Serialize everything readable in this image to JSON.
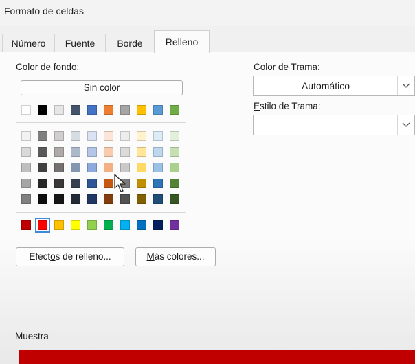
{
  "window": {
    "title": "Formato de celdas"
  },
  "tabs": [
    {
      "label": "Número",
      "active": false
    },
    {
      "label": "Fuente",
      "active": false
    },
    {
      "label": "Borde",
      "active": false
    },
    {
      "label": "Relleno",
      "active": true
    }
  ],
  "background_color": {
    "label_u": "C",
    "label_rest": "olor de fondo:",
    "no_color_label": "Sin color",
    "theme_row": [
      "#ffffff",
      "#000000",
      "#e7e6e6",
      "#44546a",
      "#4472c4",
      "#ed7d31",
      "#a5a5a5",
      "#ffc000",
      "#5b9bd5",
      "#70ad47"
    ],
    "tint_rows": [
      [
        "#f2f2f2",
        "#7f7f7f",
        "#d0cece",
        "#d6dce4",
        "#d9e1f2",
        "#fce4d6",
        "#ededed",
        "#fff2cc",
        "#ddebf7",
        "#e2efda"
      ],
      [
        "#d9d9d9",
        "#595959",
        "#aeaaaa",
        "#acb9ca",
        "#b4c6e7",
        "#f8cbad",
        "#dbdbdb",
        "#ffe699",
        "#bdd7ee",
        "#c6e0b4"
      ],
      [
        "#bfbfbf",
        "#404040",
        "#757171",
        "#8497b0",
        "#8ea9db",
        "#f4b084",
        "#c9c9c9",
        "#ffd966",
        "#9bc2e6",
        "#a9d08e"
      ],
      [
        "#a6a6a6",
        "#262626",
        "#3a3838",
        "#333f4f",
        "#2f5597",
        "#c65911",
        "#7b7b7b",
        "#bf8f00",
        "#2e75b6",
        "#548235"
      ],
      [
        "#808080",
        "#0d0d0d",
        "#161616",
        "#222b35",
        "#203764",
        "#833c0c",
        "#525252",
        "#806000",
        "#1f4e78",
        "#375623"
      ]
    ],
    "standard_row": [
      "#c00000",
      "#ff0000",
      "#ffc000",
      "#ffff00",
      "#92d050",
      "#00b050",
      "#00b0f0",
      "#0070c0",
      "#002060",
      "#7030a0"
    ],
    "selected_standard_index": 1
  },
  "buttons": {
    "fill_effects_pre": "Efect",
    "fill_effects_u": "o",
    "fill_effects_post": "s de relleno...",
    "more_colors_u": "M",
    "more_colors_rest": "ás colores..."
  },
  "pattern_color": {
    "label_pre": "Color ",
    "label_u": "d",
    "label_post": "e Trama:",
    "value": "Automático"
  },
  "pattern_style": {
    "label_u": "E",
    "label_rest": "stilo de Trama:",
    "value": ""
  },
  "sample": {
    "label": "Muestra",
    "color": "#c00000"
  }
}
